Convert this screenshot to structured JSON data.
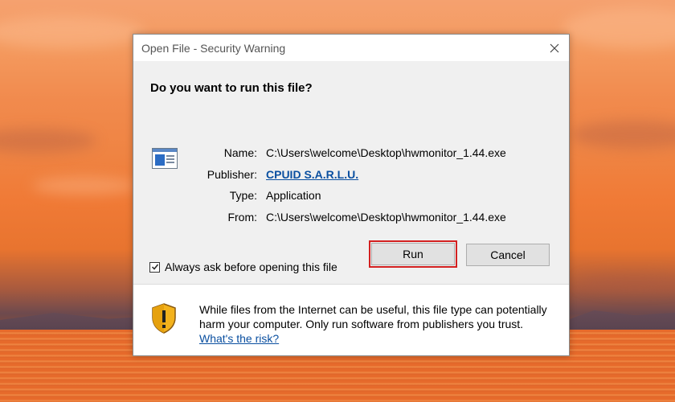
{
  "dialog": {
    "title": "Open File - Security Warning",
    "question": "Do you want to run this file?",
    "fields": [
      {
        "label": "Name:",
        "value": "C:\\Users\\welcome\\Desktop\\hwmonitor_1.44.exe"
      },
      {
        "label": "Publisher:",
        "value": "CPUID S.A.R.L.U."
      },
      {
        "label": "Type:",
        "value": "Application"
      },
      {
        "label": "From:",
        "value": "C:\\Users\\welcome\\Desktop\\hwmonitor_1.44.exe"
      }
    ],
    "run_label": "Run",
    "cancel_label": "Cancel",
    "checkbox_label": "Always ask before opening this file",
    "checkbox_checked": true,
    "warning_text": "While files from the Internet can be useful, this file type can potentially harm your computer. Only run software from publishers you trust.",
    "risk_link": "What's the risk?",
    "icons": {
      "close": "close-icon",
      "file": "application-file-icon",
      "shield": "warning-shield-icon",
      "check": "checkmark-icon"
    },
    "colors": {
      "link": "#0a4fa0",
      "run_highlight": "#d32020",
      "shield": "#f3b21c"
    }
  }
}
